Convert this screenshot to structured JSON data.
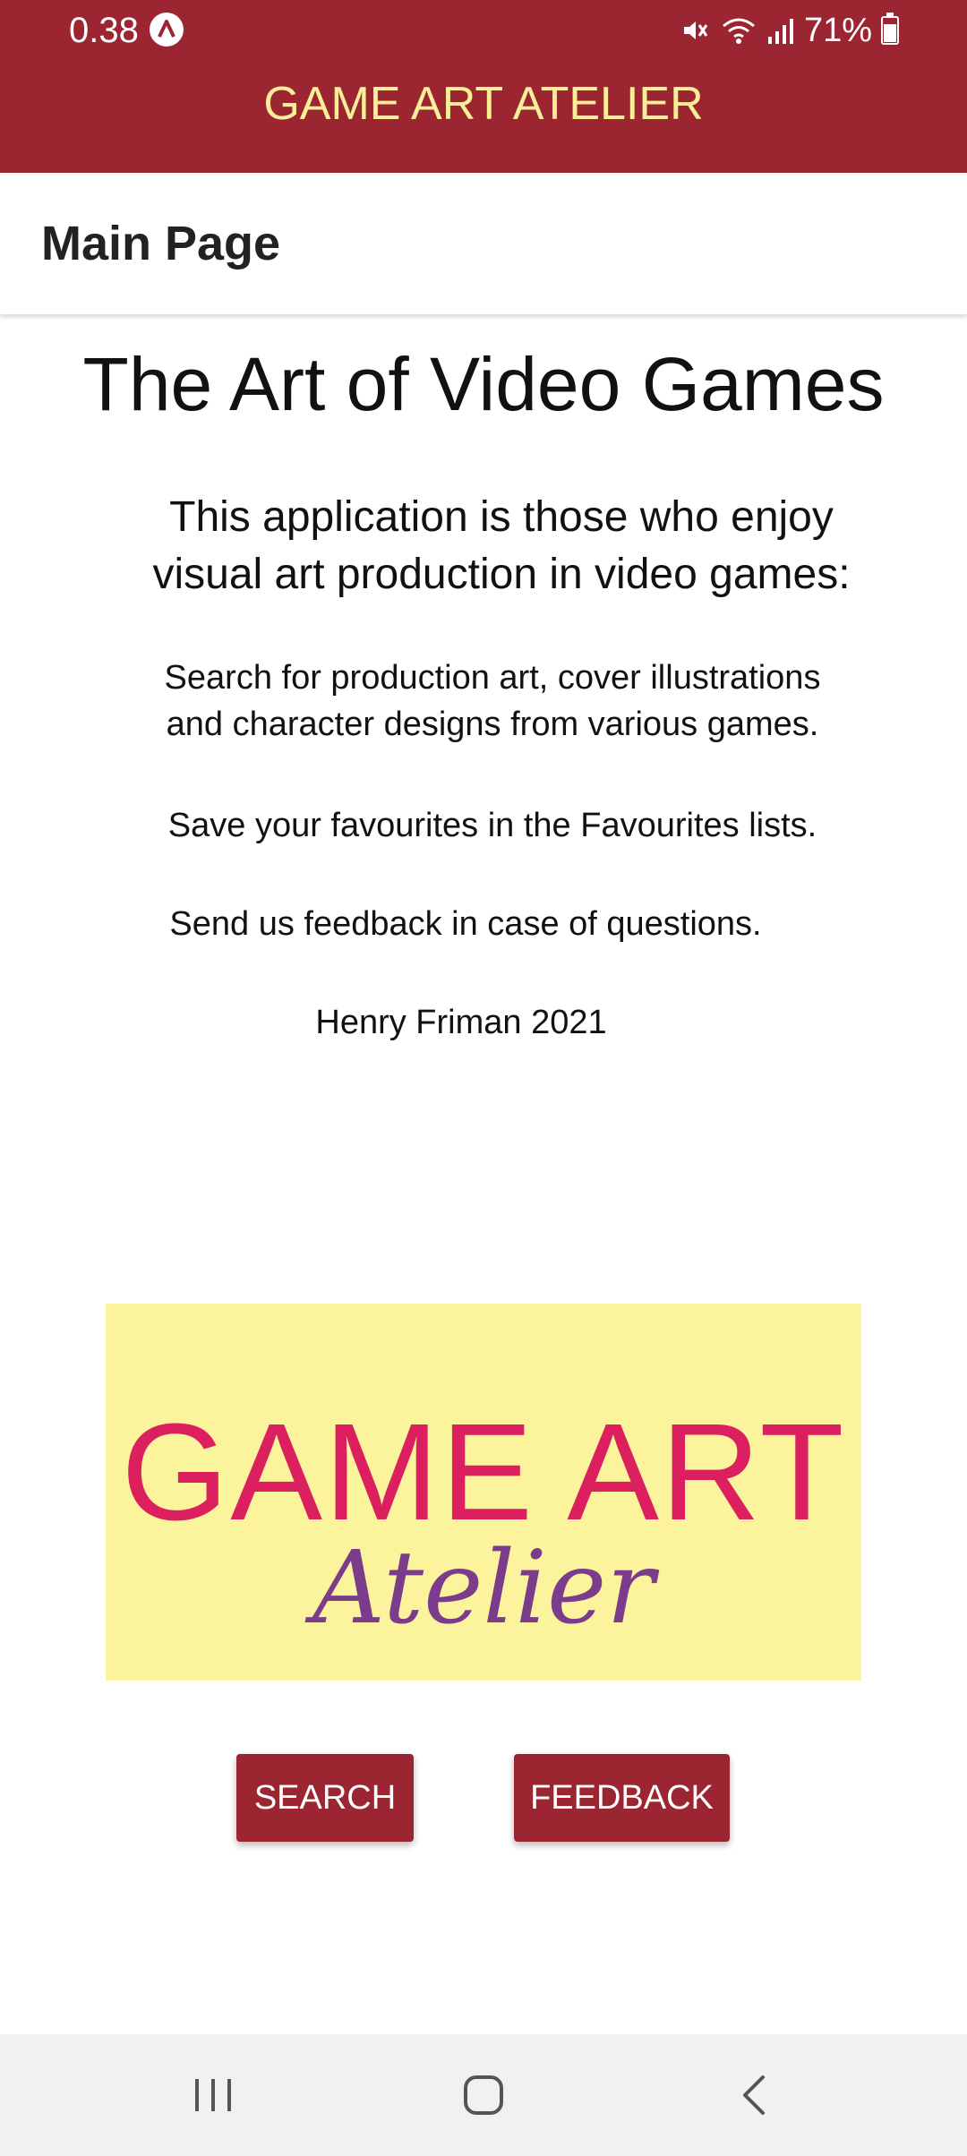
{
  "status_bar": {
    "time": "0.38",
    "battery": "71%",
    "battery_level": 0.71,
    "icons": [
      "assistant-app-icon",
      "mute-icon",
      "wifi-icon",
      "signal-icon",
      "battery-icon"
    ]
  },
  "app_bar": {
    "title": "GAME ART ATELIER"
  },
  "header": {
    "title": "Main Page"
  },
  "main": {
    "heading": "The Art of Video Games",
    "intro_line1": "This application is those who enjoy",
    "intro_line2": "visual art production in video games:",
    "search_line1": "Search for production art, cover illustrations",
    "search_line2": "and character designs from various games.",
    "favourites": "Save your favourites in the Favourites lists.",
    "feedback": "Send us feedback in case of questions.",
    "credit": "Henry Friman 2021"
  },
  "logo": {
    "main": "GAME ART",
    "sub": "Atelier"
  },
  "buttons": {
    "search": "SEARCH",
    "feedback": "FEEDBACK"
  },
  "nav_bar": {
    "icons": [
      "recents-icon",
      "home-icon",
      "back-icon"
    ]
  },
  "colors": {
    "brand": "#9b2631",
    "title_text": "#f9ef98",
    "logo_background": "#fbf49d",
    "logo_main": "#dc1f5e",
    "logo_sub": "#7b3c8c"
  }
}
